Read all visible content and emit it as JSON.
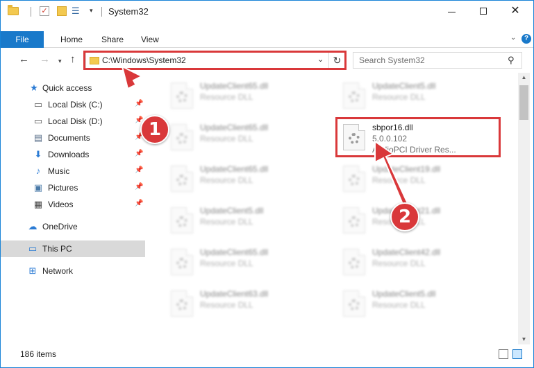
{
  "window": {
    "title": "System32",
    "min_symbol": "—",
    "close_symbol": "✕"
  },
  "quick_access_toolbar": {
    "check_symbol": "✓",
    "props_symbol": "☰",
    "dropdown_symbol": "▾"
  },
  "ribbon": {
    "tabs": [
      "File",
      "Home",
      "Share",
      "View"
    ],
    "expand_symbol": "⌄",
    "help_symbol": "?"
  },
  "nav": {
    "back_symbol": "←",
    "forward_symbol": "→",
    "recent_symbol": "▾",
    "up_symbol": "↑",
    "address": "C:\\Windows\\System32",
    "address_dropdown_symbol": "⌄",
    "refresh_symbol": "↻",
    "search_placeholder": "Search System32",
    "search_symbol": "⚲"
  },
  "sidebar": {
    "pin_symbol": "📌",
    "items": [
      {
        "label": "Quick access",
        "icon": "star-icon",
        "glyph": "★",
        "color": "#2b7bd4"
      },
      {
        "label": "Local Disk (C:)",
        "icon": "drive-icon",
        "glyph": "▭",
        "color": "#555555",
        "pinned": true
      },
      {
        "label": "Local Disk (D:)",
        "icon": "drive-icon",
        "glyph": "▭",
        "color": "#555555",
        "pinned": true
      },
      {
        "label": "Documents",
        "icon": "documents-icon",
        "glyph": "▤",
        "color": "#5a6f8a",
        "pinned": true
      },
      {
        "label": "Downloads",
        "icon": "downloads-icon",
        "glyph": "⬇",
        "color": "#2b7bd4",
        "pinned": true
      },
      {
        "label": "Music",
        "icon": "music-icon",
        "glyph": "♪",
        "color": "#2b7bd4",
        "pinned": true
      },
      {
        "label": "Pictures",
        "icon": "pictures-icon",
        "glyph": "▣",
        "color": "#4a7aa8",
        "pinned": true
      },
      {
        "label": "Videos",
        "icon": "videos-icon",
        "glyph": "▦",
        "color": "#444444",
        "pinned": true
      },
      {
        "label": "OneDrive",
        "icon": "onedrive-icon",
        "glyph": "☁",
        "color": "#2b7bd4"
      },
      {
        "label": "This PC",
        "icon": "this-pc-icon",
        "glyph": "▭",
        "color": "#2b7bd4"
      },
      {
        "label": "Network",
        "icon": "network-icon",
        "glyph": "⊞",
        "color": "#2b7bd4"
      }
    ]
  },
  "files": {
    "left": [
      {
        "name": "UpdateClient65.dll",
        "type": "Resource DLL"
      },
      {
        "name": "UpdateClient65.dll",
        "type": "Resource DLL"
      },
      {
        "name": "UpdateClient65.dll",
        "type": "Resource DLL"
      },
      {
        "name": "UpdateClient5.dll",
        "type": "Resource DLL"
      },
      {
        "name": "UpdateClient65.dll",
        "type": "Resource DLL"
      },
      {
        "name": "UpdateClient63.dll",
        "type": "Resource DLL"
      }
    ],
    "right": [
      {
        "name": "UpdateClient5.dll",
        "type": "Resource DLL"
      },
      {
        "name": "sbpor16.dll",
        "version": "5.0.0.102",
        "type": "AudioPCI Driver Res..."
      },
      {
        "name": "UpdateClient19.dll",
        "type": "Resource DLL"
      },
      {
        "name": "UpdateClient21.dll",
        "type": "Resource DLL"
      },
      {
        "name": "UpdateClient42.dll",
        "type": "Resource DLL"
      },
      {
        "name": "UpdateClient5.dll",
        "type": "Resource DLL"
      }
    ]
  },
  "scrollbar": {
    "up_symbol": "▲",
    "down_symbol": "▼"
  },
  "status": {
    "item_count": "186 items"
  },
  "callouts": {
    "one": "1",
    "two": "2"
  },
  "colors": {
    "accent": "#1979ca",
    "highlight": "#d9383a",
    "selected": "#d9d9d9"
  }
}
